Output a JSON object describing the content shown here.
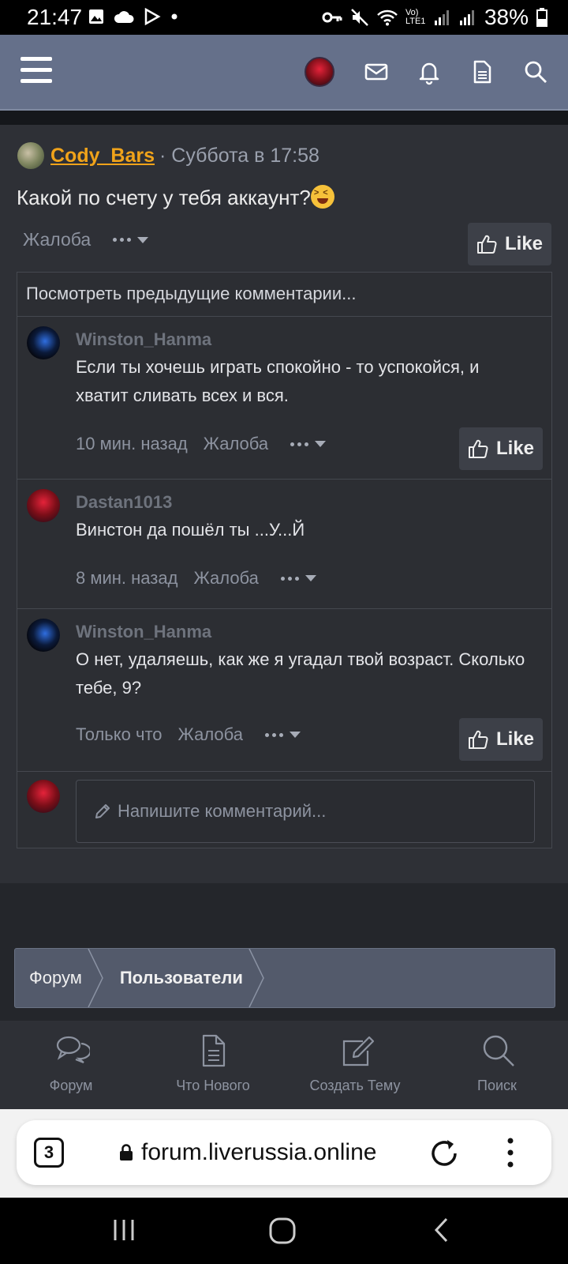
{
  "status_bar": {
    "time": "21:47",
    "battery": "38%",
    "network_label": "Vo) LTE1"
  },
  "post": {
    "author": "Cody_Bars",
    "time": "· Суббота в 17:58",
    "text": "Какой по счету у тебя аккаунт?",
    "report_label": "Жалоба",
    "like_label": "Like"
  },
  "comments_box": {
    "view_previous": "Посмотреть предыдущие комментарии...",
    "comments": [
      {
        "author": "Winston_Hanma",
        "text": "Если ты хочешь играть спокойно - то успокойся, и хватит сливать всех и вся.",
        "time": "10 мин. назад",
        "report": "Жалоба",
        "like": "Like"
      },
      {
        "author": "Dastan1013",
        "text": "Винстон да пошёл ты ...У...Й",
        "time": "8 мин. назад",
        "report": "Жалоба"
      },
      {
        "author": "Winston_Hanma",
        "text": "О нет, удаляешь, как же я угадал твой возраст. Сколько тебе, 9?",
        "time": "Только что",
        "report": "Жалоба",
        "like": "Like"
      }
    ],
    "write_placeholder": "Напишите комментарий..."
  },
  "breadcrumb": [
    "Форум",
    "Пользователи"
  ],
  "tabbar": [
    {
      "label": "Форум",
      "icon": "comments-icon"
    },
    {
      "label": "Что Нового",
      "icon": "document-icon"
    },
    {
      "label": "Создать Тему",
      "icon": "edit-icon"
    },
    {
      "label": "Поиск",
      "icon": "search-icon"
    }
  ],
  "browser": {
    "tab_count": "3",
    "url": "forum.liverussia.online"
  },
  "colors": {
    "nav": "#65708a",
    "author": "#f0a31a",
    "background": "#24262b"
  }
}
